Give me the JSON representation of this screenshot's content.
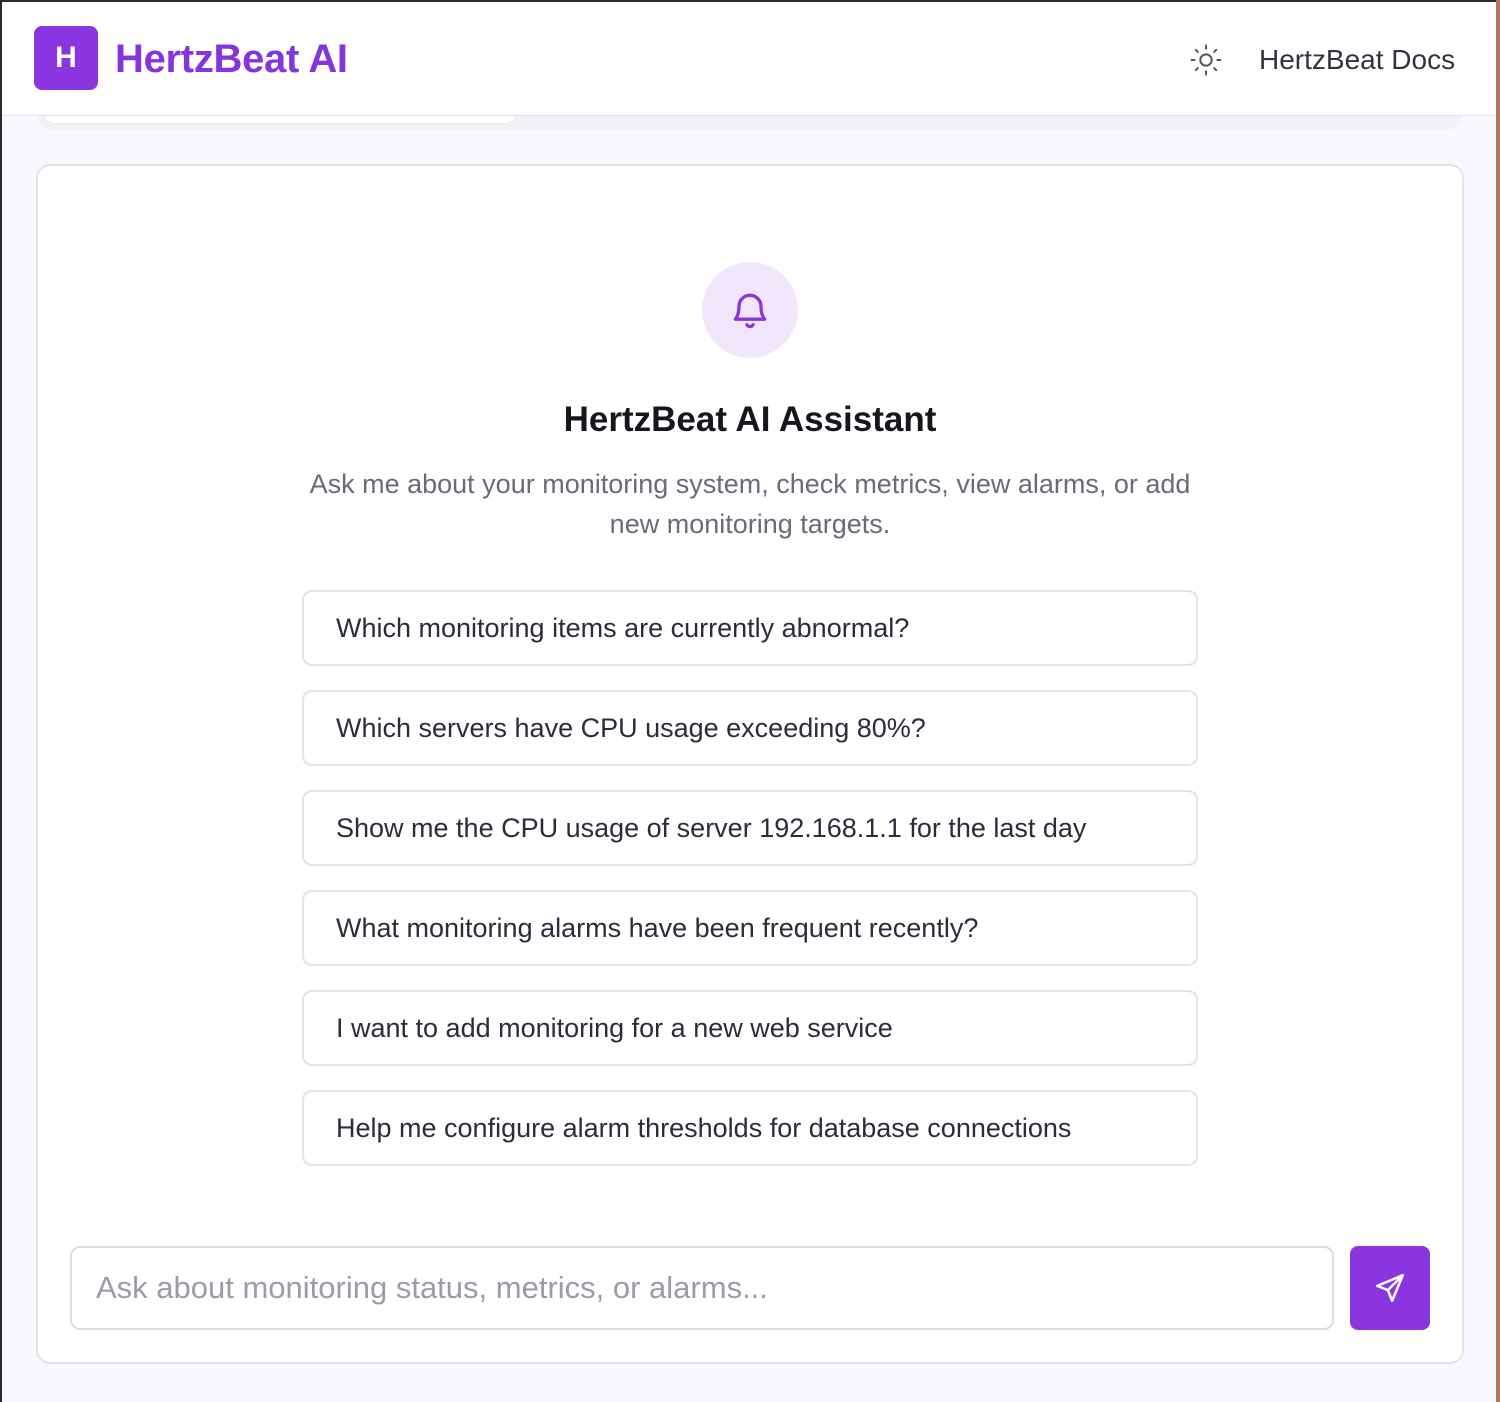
{
  "header": {
    "logo_letter": "H",
    "brand": "HertzBeat AI",
    "theme_icon": "sun-icon",
    "docs_label": "HertzBeat Docs"
  },
  "welcome": {
    "icon": "bell-icon",
    "title": "HertzBeat AI Assistant",
    "subtitle": "Ask me about your monitoring system, check metrics, view alarms, or add new monitoring targets."
  },
  "suggestions": [
    {
      "label": "Which monitoring items are currently abnormal?"
    },
    {
      "label": "Which servers have CPU usage exceeding 80%?"
    },
    {
      "label": "Show me the CPU usage of server 192.168.1.1 for the last day"
    },
    {
      "label": "What monitoring alarms have been frequent recently?"
    },
    {
      "label": "I want to add monitoring for a new web service"
    },
    {
      "label": "Help me configure alarm thresholds for database connections"
    }
  ],
  "chat": {
    "placeholder": "Ask about monitoring status, metrics, or alarms...",
    "value": "",
    "send_icon": "send-icon"
  },
  "colors": {
    "brand": "#8b35e0",
    "brand_text": "#8634dc",
    "bell_bg": "#f1e7fd"
  }
}
